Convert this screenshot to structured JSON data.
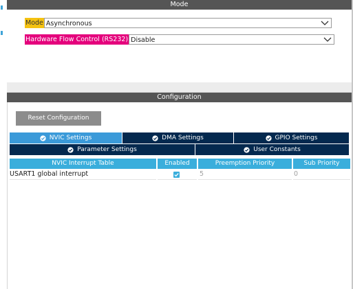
{
  "mode_section": {
    "title": "Mode",
    "fields": [
      {
        "label": "Mode",
        "value": "Asynchronous"
      },
      {
        "label": "Hardware Flow Control (RS232)",
        "value": "Disable"
      }
    ]
  },
  "config_section": {
    "title": "Configuration",
    "reset_label": "Reset Configuration",
    "tabs": [
      {
        "label": "NVIC Settings",
        "active": true
      },
      {
        "label": "DMA Settings",
        "active": false
      },
      {
        "label": "GPIO Settings",
        "active": false
      },
      {
        "label": "Parameter Settings",
        "active": false
      },
      {
        "label": "User Constants",
        "active": false
      }
    ]
  },
  "nvic_table": {
    "columns": [
      "NVIC Interrupt Table",
      "Enabled",
      "Preemption Priority",
      "Sub Priority"
    ],
    "rows": [
      {
        "name": "USART1 global interrupt",
        "enabled": true,
        "preemption": "5",
        "sub": "0"
      }
    ]
  },
  "colors": {
    "header_bar": "#555555",
    "tab_dark": "#04294f",
    "tab_active": "#3b9ad9",
    "table_header": "#3aaedc",
    "mode_label": "#f5c211",
    "hwfc_label": "#e4007c"
  }
}
